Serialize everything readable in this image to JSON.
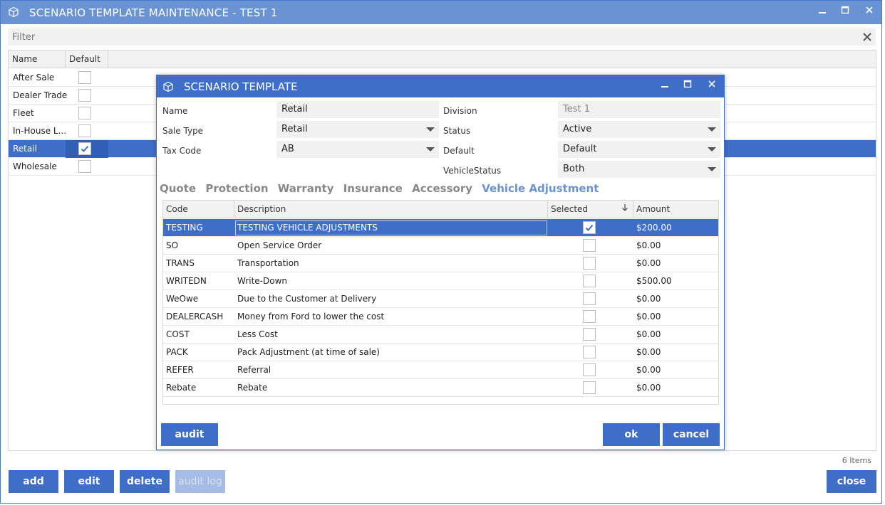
{
  "window": {
    "title": "SCENARIO TEMPLATE MAINTENANCE - TEST 1"
  },
  "filter": {
    "placeholder": "Filter"
  },
  "grid": {
    "headers": {
      "name": "Name",
      "default": "Default"
    },
    "rows": [
      {
        "name": "After Sale",
        "default": false
      },
      {
        "name": "Dealer Trade",
        "default": false
      },
      {
        "name": "Fleet",
        "default": false
      },
      {
        "name": "In-House L...",
        "default": false
      },
      {
        "name": "Retail",
        "default": true
      },
      {
        "name": "Wholesale",
        "default": false
      }
    ],
    "count_label": "6 Items"
  },
  "buttons": {
    "add": "add",
    "edit": "edit",
    "delete": "delete",
    "audit_log": "audit log",
    "close": "close"
  },
  "dialog": {
    "title": "SCENARIO TEMPLATE",
    "fields": {
      "name_label": "Name",
      "name_value": "Retail",
      "sale_type_label": "Sale Type",
      "sale_type_value": "Retail",
      "tax_code_label": "Tax Code",
      "tax_code_value": "AB",
      "division_label": "Division",
      "division_value": "Test 1",
      "status_label": "Status",
      "status_value": "Active",
      "default_label": "Default",
      "default_value": "Default",
      "vehicle_status_label": "VehicleStatus",
      "vehicle_status_value": "Both"
    },
    "tabs": [
      "Quote",
      "Protection",
      "Warranty",
      "Insurance",
      "Accessory",
      "Vehicle Adjustment"
    ],
    "active_tab": "Vehicle Adjustment",
    "table": {
      "headers": {
        "code": "Code",
        "description": "Description",
        "selected": "Selected",
        "amount": "Amount"
      },
      "rows": [
        {
          "code": "TESTING",
          "description": "TESTING VEHICLE ADJUSTMENTS",
          "selected": true,
          "amount": "$200.00"
        },
        {
          "code": "SO",
          "description": "Open Service Order",
          "selected": false,
          "amount": "$0.00"
        },
        {
          "code": "TRANS",
          "description": "Transportation",
          "selected": false,
          "amount": "$0.00"
        },
        {
          "code": "WRITEDN",
          "description": "Write-Down",
          "selected": false,
          "amount": "$500.00"
        },
        {
          "code": "WeOwe",
          "description": "Due to the Customer at Delivery",
          "selected": false,
          "amount": "$0.00"
        },
        {
          "code": "DEALERCASH",
          "description": "Money from Ford to lower the cost",
          "selected": false,
          "amount": "$0.00"
        },
        {
          "code": "COST",
          "description": "Less Cost",
          "selected": false,
          "amount": "$0.00"
        },
        {
          "code": "PACK",
          "description": "Pack Adjustment (at time of sale)",
          "selected": false,
          "amount": "$0.00"
        },
        {
          "code": "REFER",
          "description": "Referral",
          "selected": false,
          "amount": "$0.00"
        },
        {
          "code": "Rebate",
          "description": "Rebate",
          "selected": false,
          "amount": "$0.00"
        }
      ]
    },
    "buttons": {
      "audit": "audit",
      "ok": "ok",
      "cancel": "cancel"
    }
  },
  "colors": {
    "titlebar": "#6a93d4",
    "accent": "#3f6ec8",
    "disabled": "#a5bce6"
  }
}
